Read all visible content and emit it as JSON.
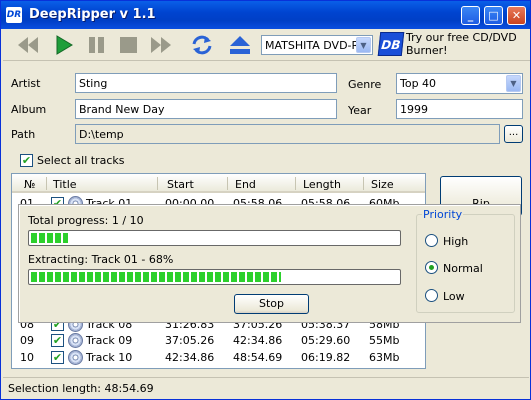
{
  "window": {
    "title": "DeepRipper v 1.1",
    "icon_text": "DR",
    "min_label": "_",
    "max_label": "□",
    "close_label": "✕"
  },
  "toolbar": {
    "buttons": [
      "rewind-icon",
      "play-icon",
      "pause-icon",
      "stop-icon",
      "fast-forward-icon",
      "refresh-icon",
      "eject-icon"
    ],
    "drive": "MATSHITA DVD-R",
    "drive_arrow": "▼",
    "promo_logo": "DB",
    "promo_text": "Try our free CD/DVD Burner!"
  },
  "fields": {
    "artist_label": "Artist",
    "artist": "Sting",
    "album_label": "Album",
    "album": "Brand New Day",
    "path_label": "Path",
    "path": "D:\\temp",
    "genre_label": "Genre",
    "genre": "Top 40",
    "year_label": "Year",
    "year": "1999",
    "browse": "..."
  },
  "select_all": {
    "label": "Select all tracks",
    "checked": true
  },
  "table": {
    "headers": [
      "№",
      "Title",
      "Start",
      "End",
      "Length",
      "Size"
    ],
    "rows": [
      {
        "n": "01",
        "title": "Track 01",
        "start": "00:00.00",
        "end": "05:58.06",
        "length": "05:58.06",
        "size": "60Mb"
      },
      {
        "n": "08",
        "title": "Track 08",
        "start": "31:26.83",
        "end": "37:05.26",
        "length": "05:38.37",
        "size": "58Mb"
      },
      {
        "n": "09",
        "title": "Track 09",
        "start": "37:05.26",
        "end": "42:34.86",
        "length": "05:29.60",
        "size": "55Mb"
      },
      {
        "n": "10",
        "title": "Track 10",
        "start": "42:34.86",
        "end": "48:54.69",
        "length": "06:19.82",
        "size": "63Mb"
      }
    ]
  },
  "rip_button": "Rip",
  "progress": {
    "total_label": "Total progress: 1 / 10",
    "total_fraction": 0.1,
    "extract_label": "Extracting: Track 01 - 68%",
    "extract_fraction": 0.68,
    "stop": "Stop"
  },
  "priority": {
    "title": "Priority",
    "options": [
      "High",
      "Normal",
      "Low"
    ],
    "selected": "Normal"
  },
  "status": {
    "text": "Selection length:  48:54.69"
  },
  "colors": {
    "accent": "#0046d5",
    "progress": "#2cd02c",
    "check": "#21a121"
  }
}
